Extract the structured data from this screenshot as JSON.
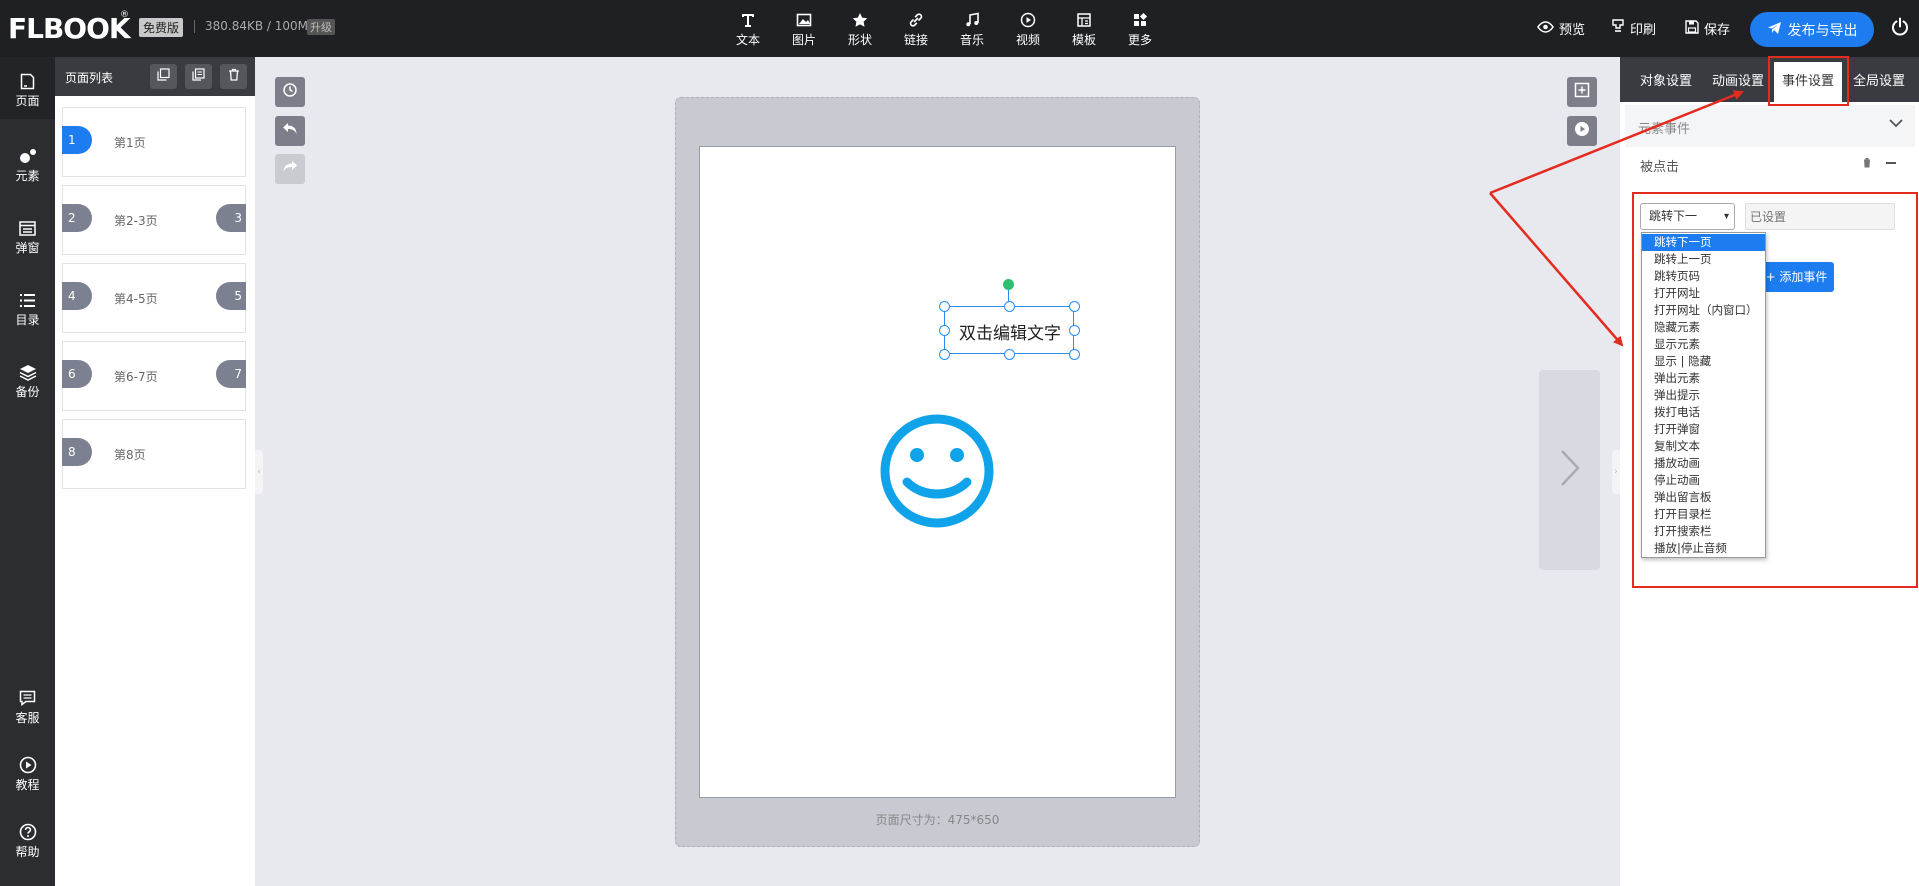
{
  "topbar": {
    "logo": "FLBOOK",
    "logo_mark": "®",
    "edition": "免费版",
    "storage_usage": "380.84KB / 100M",
    "upgrade": "升级",
    "tools": [
      {
        "label": "文本",
        "icon": "text-icon"
      },
      {
        "label": "图片",
        "icon": "image-icon"
      },
      {
        "label": "形状",
        "icon": "star-icon"
      },
      {
        "label": "链接",
        "icon": "link-icon"
      },
      {
        "label": "音乐",
        "icon": "music-icon"
      },
      {
        "label": "视频",
        "icon": "video-icon"
      },
      {
        "label": "模板",
        "icon": "template-icon"
      },
      {
        "label": "更多",
        "icon": "more-icon"
      }
    ],
    "preview": "预览",
    "print": "印刷",
    "save": "保存",
    "publish": "发布与导出"
  },
  "leftnav": {
    "items": [
      {
        "label": "页面",
        "icon": "page-icon"
      },
      {
        "label": "元素",
        "icon": "elements-icon"
      },
      {
        "label": "弹窗",
        "icon": "popup-icon"
      },
      {
        "label": "目录",
        "icon": "list-icon"
      },
      {
        "label": "备份",
        "icon": "layers-icon"
      }
    ],
    "bottom": [
      {
        "label": "客服",
        "icon": "chat-icon"
      },
      {
        "label": "教程",
        "icon": "play-icon"
      },
      {
        "label": "帮助",
        "icon": "help-icon"
      }
    ]
  },
  "pagelist": {
    "title": "页面列表",
    "pages": [
      {
        "left": "1",
        "right": "",
        "label": "第1页",
        "selected": true
      },
      {
        "left": "2",
        "right": "3",
        "label": "第2-3页"
      },
      {
        "left": "4",
        "right": "5",
        "label": "第4-5页"
      },
      {
        "left": "6",
        "right": "7",
        "label": "第6-7页"
      },
      {
        "left": "8",
        "right": "",
        "label": "第8页"
      }
    ]
  },
  "canvas": {
    "text_element": "双击编辑文字",
    "page_size": "页面尺寸为：475*650"
  },
  "rightpanel": {
    "tabs": [
      "对象设置",
      "动画设置",
      "事件设置",
      "全局设置"
    ],
    "active_tab": "事件设置",
    "section_title": "元素事件",
    "event_name": "被点击",
    "action_value": "跳转下一页",
    "action_display": "跳转下一",
    "param_placeholder": "已设置",
    "add_event": "+ 添加事件",
    "action_options": [
      "跳转下一页",
      "跳转上一页",
      "跳转页码",
      "打开网址",
      "打开网址（内窗口）",
      "隐藏元素",
      "显示元素",
      "显示 | 隐藏",
      "弹出元素",
      "弹出提示",
      "拨打电话",
      "打开弹窗",
      "复制文本",
      "播放动画",
      "停止动画",
      "弹出留言板",
      "打开目录栏",
      "打开搜索栏",
      "播放|停止音频"
    ]
  },
  "colors": {
    "accent": "#1c7cf0",
    "topbar": "#1f2024",
    "annotation": "#e52b20",
    "smiley": "#11a3ea"
  }
}
